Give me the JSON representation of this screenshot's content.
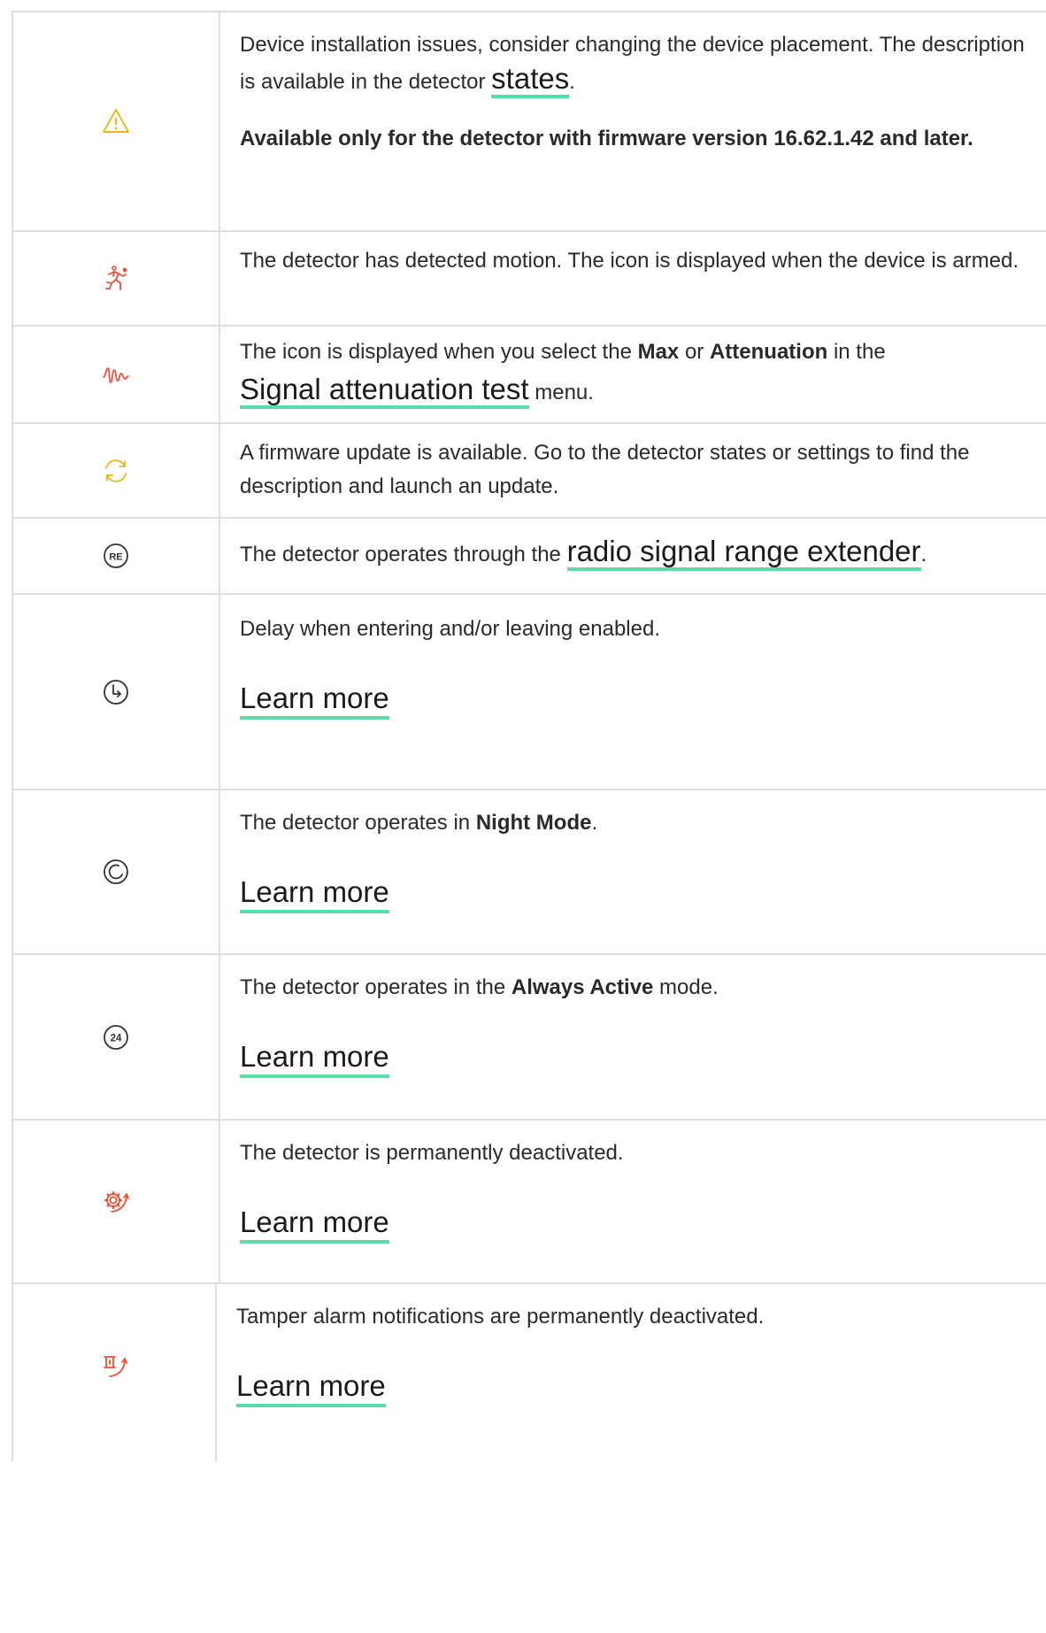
{
  "colors": {
    "warning": "#e9b81d",
    "alert": "#e8513b",
    "update": "#e9b81d",
    "neutral": "#333333",
    "link_underline": "#55dfa6",
    "border": "#dedede"
  },
  "rows": [
    {
      "icon": "warning-triangle-icon",
      "pre": "Device installation issues, consider changing the device placement. The description is available in the detector ",
      "link": "states",
      "post": ".",
      "note": "Available only for the detector with firmware version 16.62.1.42 and later."
    },
    {
      "icon": "motion-running-person-icon",
      "text": "The detector has detected motion. The icon is displayed when the device is armed."
    },
    {
      "icon": "signal-wave-icon",
      "pre": "The icon is displayed when you select the ",
      "bold1": "Max",
      "mid": " or ",
      "bold2": "Attenuation",
      "post": " in the ",
      "link": "Signal attenuation test",
      "tail": " menu."
    },
    {
      "icon": "firmware-update-icon",
      "text": "A firmware update is available. Go to the detector states or settings to find the description and launch an update."
    },
    {
      "icon": "range-extender-re-icon",
      "icon_label": "RE",
      "pre": "The detector operates through the ",
      "link": "radio signal range extender",
      "post": "."
    },
    {
      "icon": "delay-clock-icon",
      "text": "Delay when entering and/or leaving enabled.",
      "link": "Learn more"
    },
    {
      "icon": "night-mode-icon",
      "pre": "The detector operates in ",
      "bold": "Night Mode",
      "post": ".",
      "link": "Learn more"
    },
    {
      "icon": "always-active-24-icon",
      "icon_label": "24",
      "pre": "The detector operates in the ",
      "bold": "Always Active",
      "post": " mode.",
      "link": "Learn more"
    },
    {
      "icon": "permanently-deactivated-gear-icon",
      "text": "The detector is permanently deactivated.",
      "link": "Learn more"
    },
    {
      "icon": "tamper-deactivated-icon",
      "text": "Tamper alarm notifications are permanently deactivated.",
      "link": "Learn more"
    }
  ]
}
